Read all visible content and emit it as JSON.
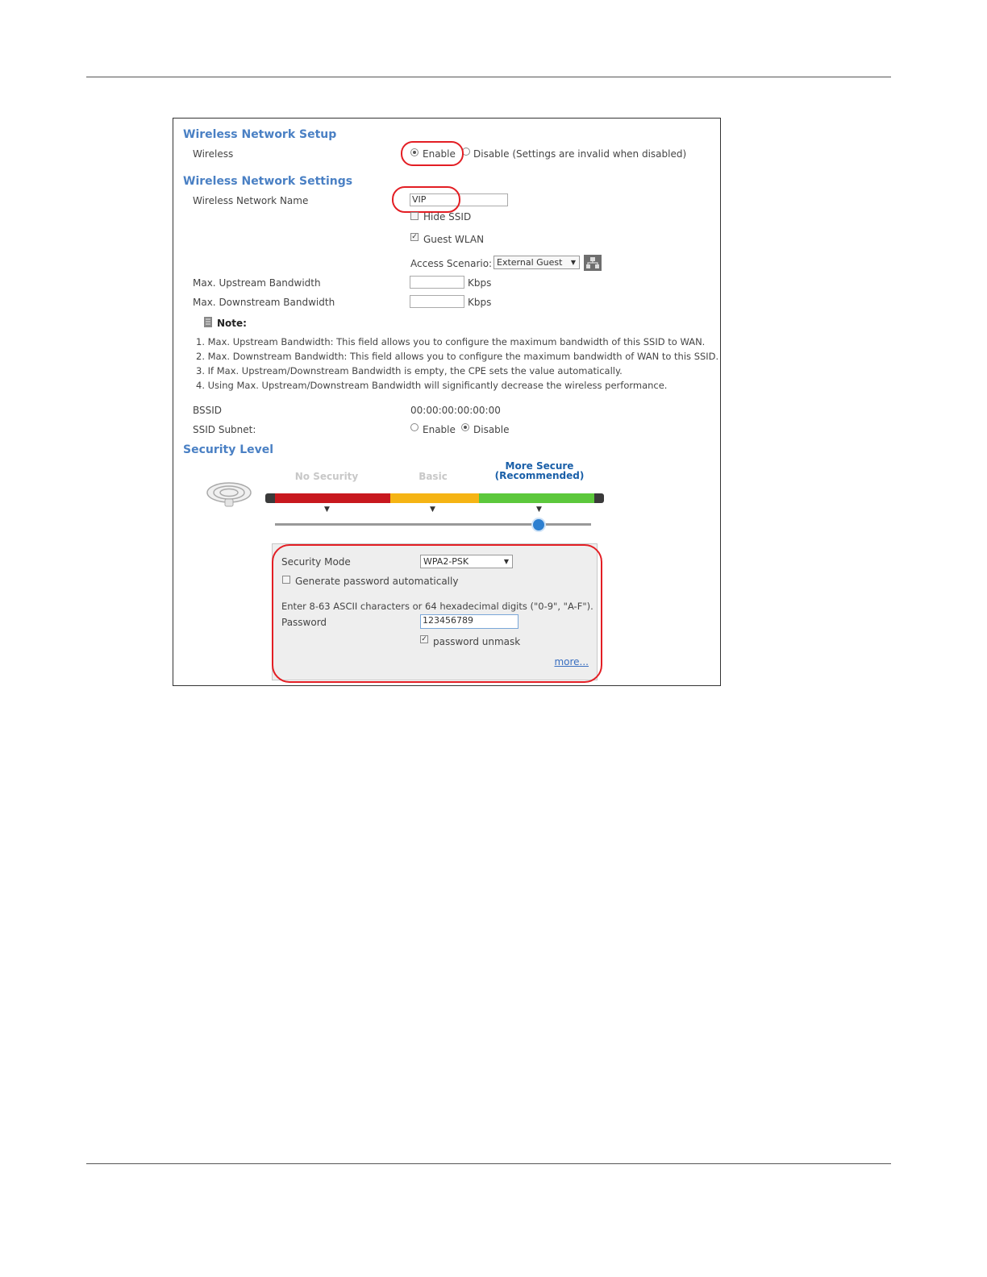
{
  "setup": {
    "title": "Wireless Network Setup",
    "wireless_label": "Wireless",
    "enable": "Enable",
    "disable": "Disable (Settings are invalid when disabled)"
  },
  "settings": {
    "title": "Wireless Network Settings",
    "name_label": "Wireless Network Name",
    "name_value": "VIP",
    "hide_ssid": "Hide SSID",
    "guest_wlan": "Guest WLAN",
    "access_scenario_label": "Access Scenario:",
    "access_scenario_value": "External Guest",
    "upstream_label": "Max. Upstream Bandwidth",
    "downstream_label": "Max. Downstream Bandwidth",
    "kbps": "Kbps",
    "note_title": "Note:",
    "notes": [
      "1. Max. Upstream Bandwidth: This field allows you to configure the maximum bandwidth of this SSID to WAN.",
      "2. Max. Downstream Bandwidth: This field allows you to configure the maximum bandwidth of WAN to this SSID.",
      "3. If Max. Upstream/Downstream Bandwidth is empty, the CPE sets the value automatically.",
      "4. Using Max. Upstream/Downstream Bandwidth will significantly decrease the wireless performance."
    ],
    "bssid_label": "BSSID",
    "bssid_value": "00:00:00:00:00:00",
    "ssid_subnet_label": "SSID Subnet:",
    "subnet_enable": "Enable",
    "subnet_disable": "Disable"
  },
  "security": {
    "title": "Security Level",
    "level_none": "No Security",
    "level_basic": "Basic",
    "level_more_1": "More Secure",
    "level_more_2": "(Recommended)",
    "mode_label": "Security Mode",
    "mode_value": "WPA2-PSK",
    "generate_label": "Generate password automatically",
    "hint": "Enter 8-63 ASCII characters or 64 hexadecimal digits (\"0-9\", \"A-F\").",
    "password_label": "Password",
    "password_value": "123456789",
    "unmask_label": "password unmask",
    "more_link": "more..."
  },
  "colors": {
    "section": "#4a80c4",
    "highlight": "#e31e24",
    "bar_red": "#c8181e",
    "bar_yellow": "#f5b414",
    "bar_green": "#5cc83c"
  }
}
